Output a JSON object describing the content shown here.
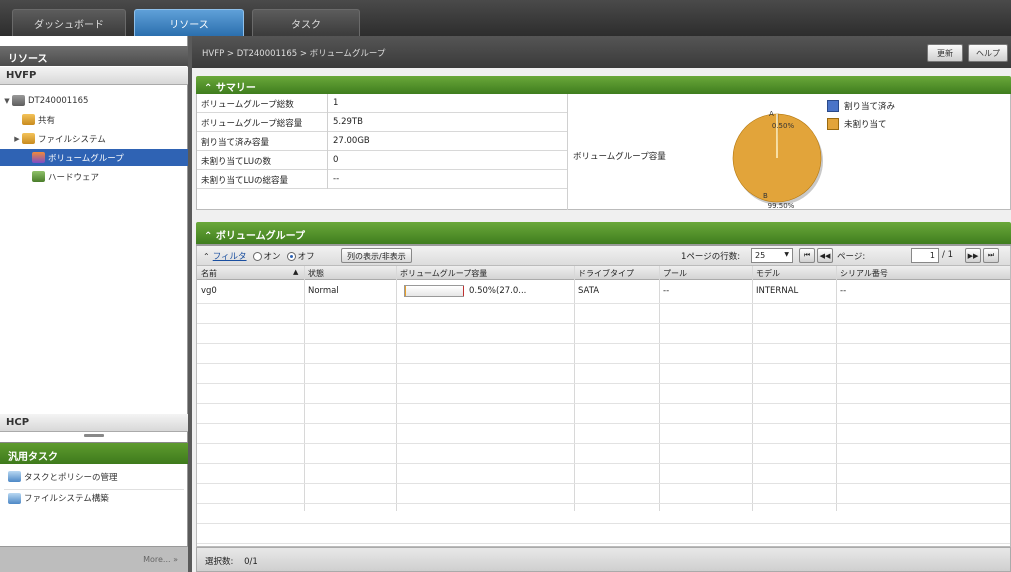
{
  "top_tabs": [
    {
      "label": "ダッシュボード",
      "active": false
    },
    {
      "label": "リソース",
      "active": true
    },
    {
      "label": "タスク",
      "active": false
    }
  ],
  "left": {
    "resources_header": "リソース",
    "hvfp_label": "HVFP",
    "tree": {
      "root": "DT240001165",
      "items": [
        {
          "label": "共有"
        },
        {
          "label": "ファイルシステム"
        },
        {
          "label": "ボリュームグループ"
        },
        {
          "label": "ハードウェア"
        }
      ]
    },
    "hcp_label": "HCP",
    "general_tasks_header": "汎用タスク",
    "tasks": [
      {
        "label": "タスクとポリシーの管理"
      },
      {
        "label": "ファイルシステム構築"
      }
    ],
    "more_label": "More... »"
  },
  "header": {
    "breadcrumb": "HVFP > DT240001165 > ボリュームグループ",
    "update_button": "更新",
    "help_button": "ヘルプ"
  },
  "summary": {
    "title": "サマリー",
    "rows": [
      {
        "key": "ボリュームグループ総数",
        "value": "1"
      },
      {
        "key": "ボリュームグループ総容量",
        "value": "5.29TB"
      },
      {
        "key": "割り当て済み容量",
        "value": "27.00GB"
      },
      {
        "key": "未割り当てLUの数",
        "value": "0"
      },
      {
        "key": "未割り当てLUの総容量",
        "value": "--"
      }
    ],
    "capacity_label": "ボリュームグループ容量",
    "legend": [
      {
        "label": "割り当て済み",
        "color": "#4a74c8"
      },
      {
        "label": "未割り当て",
        "color": "#e2a43a"
      }
    ]
  },
  "chart_data": {
    "type": "pie",
    "categories": [
      "割り当て済み",
      "未割り当て"
    ],
    "values": [
      0.5,
      99.5
    ],
    "colors": [
      "#4a74c8",
      "#e2a43a"
    ],
    "slice_labels": [
      "A",
      "B"
    ],
    "value_labels": [
      "0.50%",
      "99.50%"
    ]
  },
  "volume_groups": {
    "title": "ボリュームグループ",
    "filter_link": "フィルタ",
    "filter_on": "オン",
    "filter_off": "オフ",
    "column_toggle_button": "列の表示/非表示",
    "rows_per_page_label": "1ページの行数:",
    "rows_per_page": "25",
    "page_label": "ページ:",
    "page_value": "1",
    "page_total": "/ 1",
    "columns": [
      "名前",
      "状態",
      "ボリュームグループ容量",
      "ドライブタイプ",
      "プール",
      "モデル",
      "シリアル番号"
    ],
    "rows": [
      {
        "name": "vg0",
        "status": "Normal",
        "capacity": "0.50%(27.0...",
        "capacity_pct": 0.5,
        "drive_type": "SATA",
        "pool": "--",
        "model": "INTERNAL",
        "serial": "--"
      }
    ],
    "selected_label": "選択数:",
    "selected_value": "0/1"
  }
}
